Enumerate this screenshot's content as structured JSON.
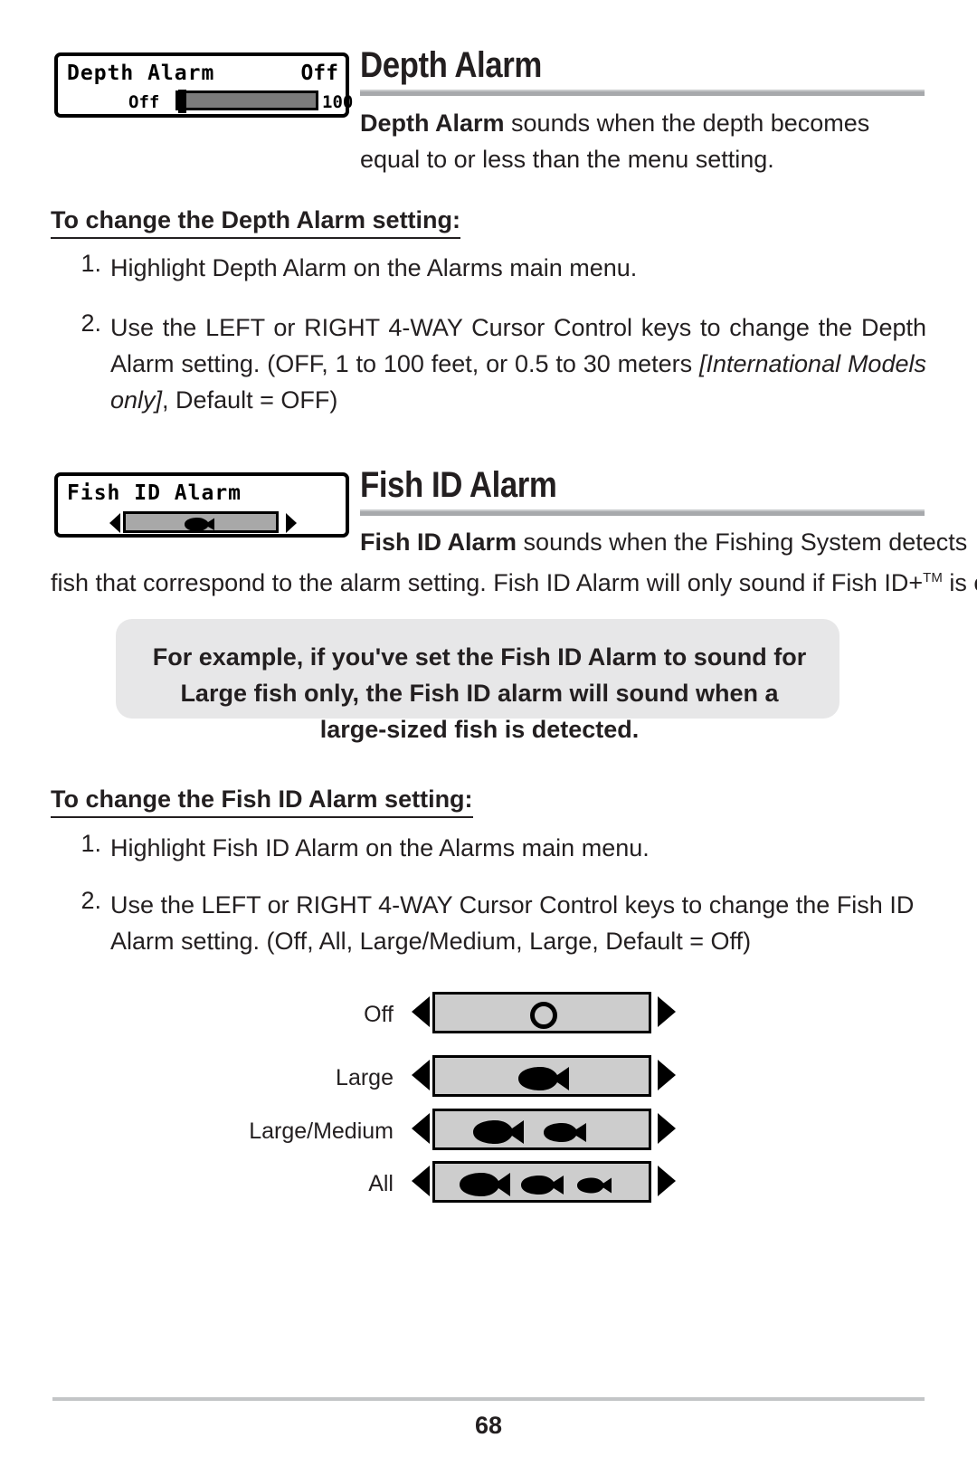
{
  "page": {
    "number": "68"
  },
  "section1": {
    "heading": "Depth Alarm",
    "lcd": {
      "title": "Depth Alarm",
      "value": "Off",
      "min_label": "Off",
      "max_label": "100"
    },
    "intro_bold": "Depth Alarm",
    "intro_rest": " sounds when the depth becomes equal to or less than the menu setting.",
    "subhead": "To change the Depth Alarm setting:",
    "steps": [
      {
        "num": "1.",
        "text": "Highlight Depth Alarm on the Alarms main menu."
      },
      {
        "num": "2.",
        "text_before": "Use the LEFT or RIGHT 4-WAY Cursor Control keys to change the Depth Alarm setting. (OFF, 1 to 100 feet, or 0.5 to 30 meters ",
        "emphasis": "[International Models only]",
        "text_after": ", Default = OFF)"
      }
    ]
  },
  "section2": {
    "heading": "Fish ID Alarm",
    "lcd": {
      "title": "Fish ID Alarm",
      "icon": "fish-icon"
    },
    "intro_bold": "Fish ID Alarm",
    "intro_rest_a": " sounds when the Fishing System detects fish that correspond to the alarm setting. Fish ID Alarm will only sound if Fish ID+",
    "trademark": "TM",
    "intro_rest_b": " is on.",
    "callout": "For example, if you've set the Fish ID Alarm to sound for Large fish only, the Fish ID alarm will sound when a large-sized fish is detected.",
    "subhead": "To change the Fish ID Alarm setting:",
    "steps": [
      {
        "num": "1.",
        "text": "Highlight Fish ID Alarm on the Alarms main menu."
      },
      {
        "num": "2.",
        "text": "Use the LEFT or RIGHT 4-WAY Cursor Control keys to change the Fish ID Alarm setting. (Off, All, Large/Medium, Large, Default = Off)"
      }
    ],
    "settings_diagram": [
      {
        "label": "Off",
        "symbol": "circle",
        "fish_count": 0
      },
      {
        "label": "Large",
        "symbol": "fish",
        "fish_count": 1
      },
      {
        "label": "Large/Medium",
        "symbol": "fish",
        "fish_count": 2
      },
      {
        "label": "All",
        "symbol": "fish",
        "fish_count": 3
      }
    ]
  },
  "colors": {
    "text": "#231f20",
    "rule": "#a7a9ac",
    "callout_bg": "#e7e7e8",
    "lcd_bar": "#7b7b7b",
    "diagram_bar": "#cdcdcd"
  }
}
